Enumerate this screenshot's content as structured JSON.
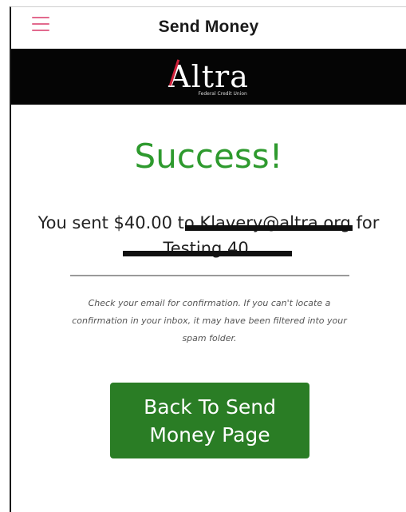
{
  "header": {
    "title": "Send Money",
    "menu_icon": "hamburger-menu-icon"
  },
  "brand": {
    "logo_text": "Altra",
    "logo_subtext": "Federal Credit Union"
  },
  "main": {
    "status_title": "Success!",
    "sent_message": "You sent $40.00 to Klavery@altra.org for Testing 40.",
    "note": "Check your email for confirmation. If you can't locate a confirmation in your inbox, it may have been filtered into your spam folder.",
    "back_button_label": "Back To Send Money Page"
  },
  "colors": {
    "success_green": "#2e9a2e",
    "button_green": "#2a7d25",
    "brand_bar": "#050505",
    "menu_icon": "#e26a8e"
  }
}
